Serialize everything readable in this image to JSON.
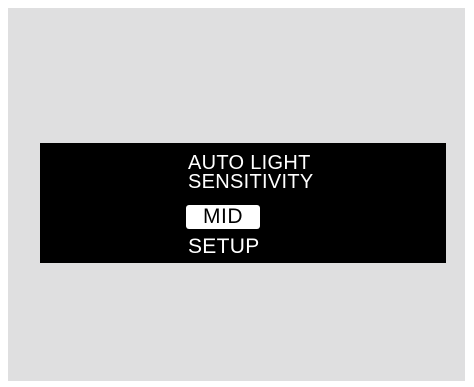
{
  "display": {
    "title_line1": "AUTO LIGHT",
    "title_line2": "SENSITIVITY",
    "selected_option": "MID",
    "menu_item": "SETUP"
  },
  "colors": {
    "background": "#dfdfe0",
    "display_background": "#000000",
    "text": "#ffffff",
    "highlight_background": "#ffffff",
    "highlight_text": "#000000"
  }
}
